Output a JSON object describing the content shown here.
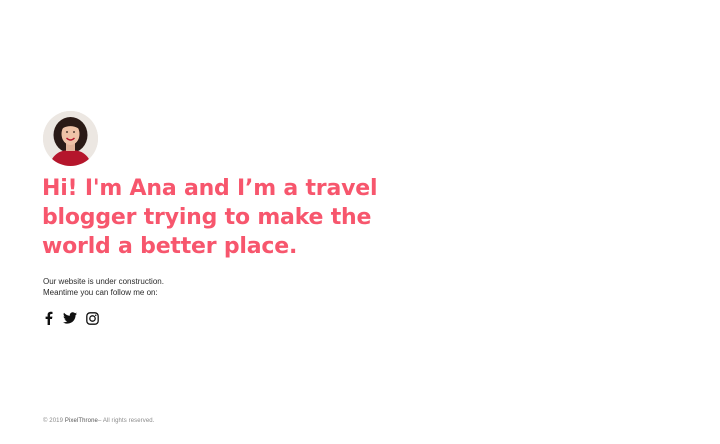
{
  "profile": {
    "avatar_icon": "portrait-photo"
  },
  "headline": "Hi! I'm Ana and I’m a travel blogger trying to make the world a better place.",
  "message": {
    "line1": "Our website is under construction.",
    "line2": "Meantime you can follow me on:"
  },
  "social": [
    {
      "icon": "facebook-icon"
    },
    {
      "icon": "twitter-icon"
    },
    {
      "icon": "instagram-icon"
    }
  ],
  "footer": {
    "copyright": "© 2019",
    "brand": "PixelThrone",
    "rights": "– All rights reserved."
  },
  "colors": {
    "accent": "#f7566d",
    "text": "#2b2b2b",
    "muted": "#8a8a8a"
  }
}
